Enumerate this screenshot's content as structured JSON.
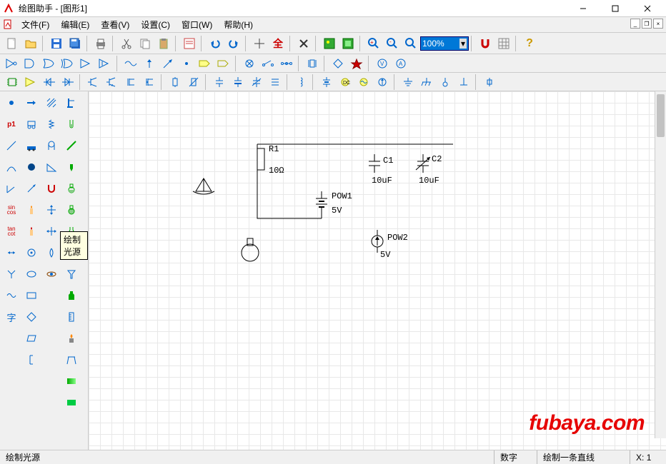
{
  "title": "绘图助手 - [图形1]",
  "menu": {
    "file": "文件(F)",
    "edit": "编辑(E)",
    "view": "查看(V)",
    "settings": "设置(C)",
    "window": "窗口(W)",
    "help": "帮助(H)"
  },
  "toolbar1": {
    "zoom_value": "100%"
  },
  "tooltip": {
    "label": "绘制光源"
  },
  "canvas": {
    "components": {
      "r1": {
        "name": "R1",
        "value": "10Ω"
      },
      "c1": {
        "name": "C1",
        "value": "10uF"
      },
      "c2": {
        "name": "C2",
        "value": "10uF"
      },
      "pow1": {
        "name": "POW1",
        "value": "5V"
      },
      "pow2": {
        "name": "POW2",
        "value": "5V"
      }
    }
  },
  "watermark": "fubaya.com",
  "statusbar": {
    "hint": "绘制光源",
    "digits": "数字",
    "mode": "绘制一条直线",
    "x_label": "X:",
    "x_value": "1"
  },
  "palette_p1": "p1"
}
